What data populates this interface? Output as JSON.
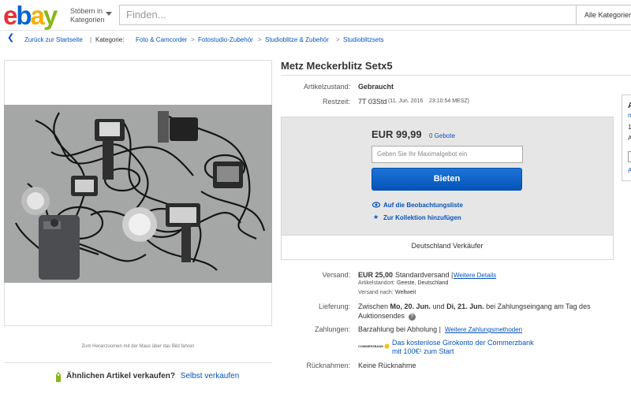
{
  "header": {
    "logo_letters": [
      "e",
      "b",
      "a",
      "y"
    ],
    "browse_label_1": "Stöbern in",
    "browse_label_2": "Kategorien",
    "search_placeholder": "Finden...",
    "category_select": "Alle Kategorien"
  },
  "breadcrumb": {
    "back_label": "Zurück zur Startseite",
    "category_label": "Kategorie:",
    "items": [
      "Foto & Camcorder",
      "Fotostudio-Zubehör",
      "Studioblitze & Zubehör",
      "Studioblitzsets"
    ]
  },
  "gallery": {
    "zoom_note": "Zum Heranzoomen mit der Maus über das Bild fahren",
    "sell_prompt": "Ähnlichen Artikel verkaufen?",
    "sell_link": "Selbst verkaufen"
  },
  "item": {
    "title": "Metz Meckerblitz Setx5",
    "condition_label": "Artikelzustand:",
    "condition_value": "Gebraucht",
    "time_left_label": "Restzeit:",
    "time_left_value": "7T 03Std",
    "time_left_end": "(11. Jun. 2016",
    "time_left_clock": "23:10:54 MESZ)"
  },
  "bid": {
    "price": "EUR 99,99",
    "bid_count": "0 Gebote",
    "input_placeholder": "Geben Sie Ihr Maximalgebot ein",
    "bid_button": "Bieten",
    "watch_link": "Auf die Beobachtungsliste",
    "collection_link": "Zur Kollektion hinzufügen",
    "seller_location": "Deutschland Verkäufer"
  },
  "shipping": {
    "label": "Versand:",
    "cost": "EUR 25,00",
    "method": "Standardversand |",
    "details_link": "Weitere Details",
    "item_location_label": "Artikelstandort:",
    "item_location_value": "Geeste, Deutschland",
    "ships_to_label": "Versand nach:",
    "ships_to_value": "Weltweit"
  },
  "delivery": {
    "label": "Lieferung:",
    "text_1": "Zwischen",
    "date_1": "Mo, 20. Jun.",
    "text_2": "und",
    "date_2": "Di, 21. Jun.",
    "text_3": "bei Zahlungseingang am Tag des",
    "text_4": "Auktionsendes"
  },
  "payment": {
    "label": "Zahlungen:",
    "value": "Barzahlung bei Abholung |",
    "more_link": "Weitere Zahlungsmethoden",
    "bank_logo": "COMMERZBANK",
    "promo_1": "Das kostenlose Girokonto der Commerzbank",
    "promo_2": "mit 100€¹ zum Start"
  },
  "returns": {
    "label": "Rücknahmen:",
    "value": "Keine Rücknahme"
  },
  "side_panel": {
    "lines": [
      "A",
      "n",
      "1",
      "A",
      "",
      "A"
    ]
  },
  "colors": {
    "link": "#0654ba",
    "bid_button": "#0654ba",
    "ebay_red": "#e53238",
    "ebay_blue": "#0064d2",
    "ebay_yellow": "#f5af02",
    "ebay_green": "#86b817"
  }
}
